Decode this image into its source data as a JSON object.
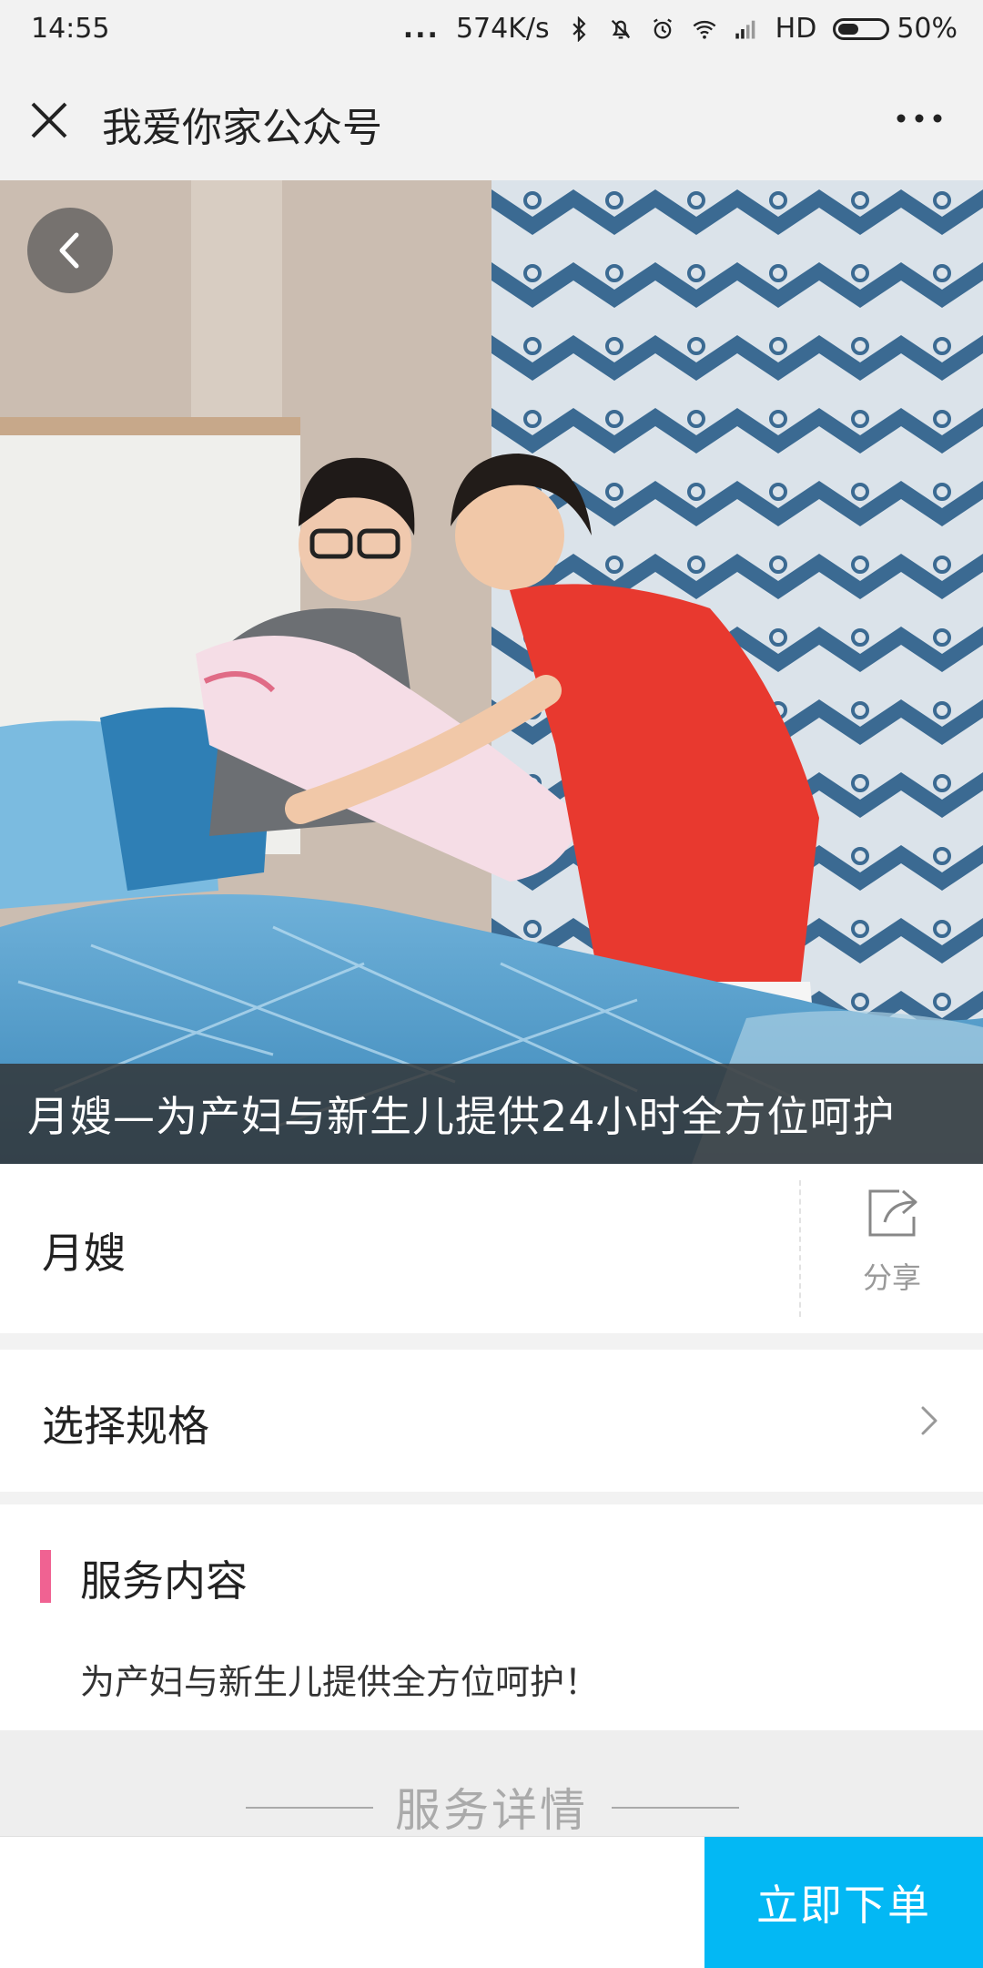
{
  "status_bar": {
    "time": "14:55",
    "dots": "...",
    "speed": "574K/s",
    "network": "HD",
    "battery": "50%",
    "battery_level": 0.5
  },
  "nav": {
    "title": "我爱你家公众号",
    "close_icon": "close-icon",
    "more_icon": "more-dots-icon"
  },
  "hero": {
    "caption": "月嫂—为产妇与新生儿提供24小时全方位呵护",
    "back_icon": "chevron-left-icon"
  },
  "product": {
    "name": "月嫂",
    "share_label": "分享",
    "share_icon": "share-icon"
  },
  "spec": {
    "label": "选择规格",
    "arrow_icon": "chevron-right-icon"
  },
  "service": {
    "title": "服务内容",
    "description": "为产妇与新生儿提供全方位呵护！",
    "accent_color": "#f06292"
  },
  "details": {
    "title": "服务详情"
  },
  "bottom": {
    "order_label": "立即下单",
    "button_color": "#03b8f4"
  }
}
